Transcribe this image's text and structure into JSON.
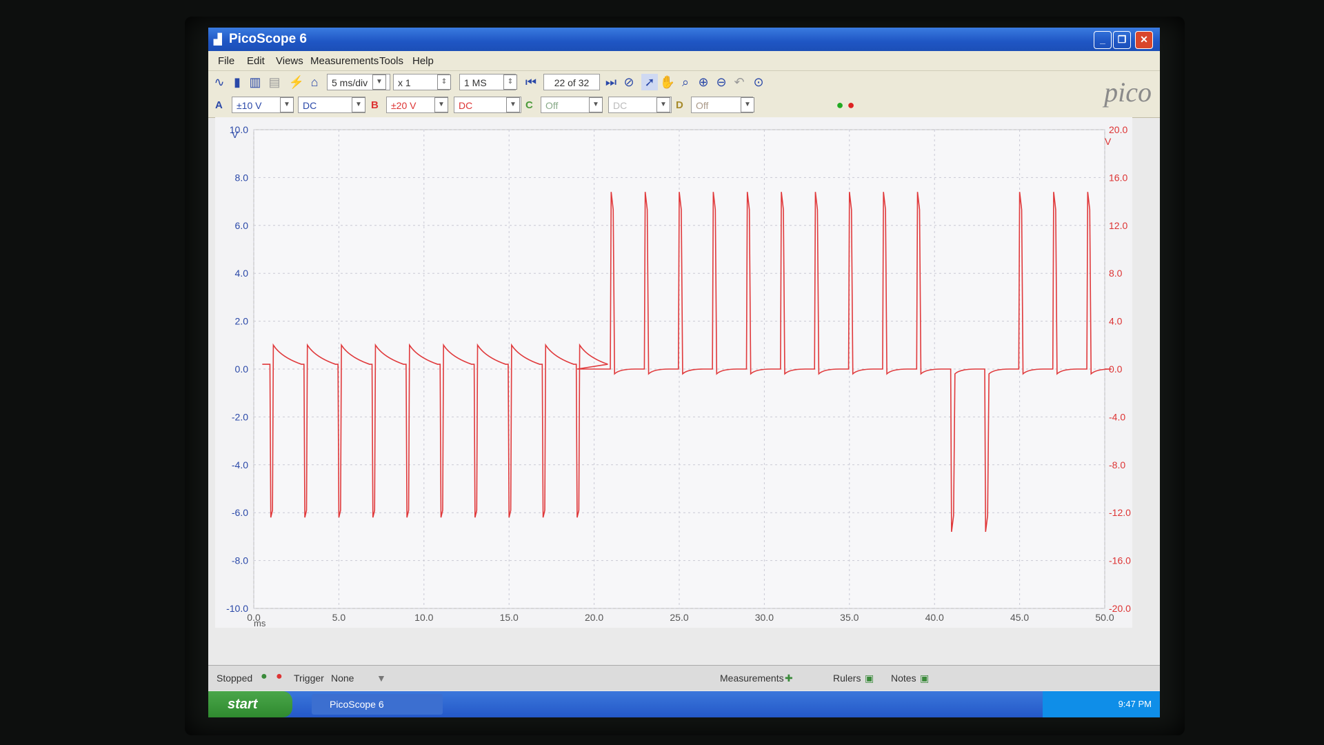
{
  "window": {
    "title": "PicoScope 6"
  },
  "menu": [
    "File",
    "Edit",
    "Views",
    "Measurements",
    "Tools",
    "Help"
  ],
  "toolbar": {
    "timebase": "5 ms/div",
    "zoom": "x 1",
    "samples": "1 MS",
    "buffer": "22 of 32"
  },
  "channels": {
    "a": {
      "label": "A",
      "range": "±10 V",
      "coupling": "DC"
    },
    "b": {
      "label": "B",
      "range": "±20 V",
      "coupling": "DC"
    },
    "c": {
      "label": "C",
      "range": "Off",
      "coupling": "DC"
    },
    "d": {
      "label": "D",
      "range": "Off"
    }
  },
  "logo": "pico",
  "chart_data": {
    "type": "line",
    "xlabel": "ms",
    "xlim": [
      0,
      50
    ],
    "x_ticks": [
      "0.0",
      "5.0",
      "10.0",
      "15.0",
      "20.0",
      "25.0",
      "30.0",
      "35.0",
      "40.0",
      "45.0",
      "50.0"
    ],
    "left_axis": {
      "unit": "V",
      "range": [
        -10,
        10
      ],
      "ticks": [
        "10.0",
        "8.0",
        "6.0",
        "4.0",
        "2.0",
        "0.0",
        "-2.0",
        "-4.0",
        "-6.0",
        "-8.0",
        "-10.0"
      ]
    },
    "right_axis": {
      "unit": "V",
      "range": [
        -20,
        20
      ],
      "ticks": [
        "20.0",
        "16.0",
        "12.0",
        "8.0",
        "4.0",
        "0.0",
        "-4.0",
        "-8.0",
        "-12.0",
        "-16.0",
        "-20.0"
      ]
    },
    "series": [
      {
        "channel": "B",
        "color": "#e0393b",
        "phase1": {
          "x_start": 0.5,
          "x_end": 19.0,
          "baseline_v": 0.2,
          "negative_pulses_ms": [
            1.0,
            3.0,
            5.0,
            7.0,
            9.0,
            11.0,
            13.0,
            15.0,
            17.0,
            19.0
          ],
          "negative_peak_v": -6.2
        },
        "phase2": {
          "x_start": 19.0,
          "x_end": 50.0,
          "baseline_v": 0.0,
          "positive_pulses_ms": [
            21.0,
            23.0,
            25.0,
            27.0,
            29.0,
            31.0,
            33.0,
            35.0,
            37.0,
            39.0,
            45.0,
            47.0,
            49.0
          ],
          "positive_peak_v": 7.4,
          "negative_pulses_ms": [
            41.0,
            43.0
          ],
          "negative_peak_v": -6.8
        }
      }
    ]
  },
  "status": {
    "state": "Stopped",
    "trigger_label": "Trigger",
    "trigger_value": "None",
    "measurements": "Measurements",
    "rulers": "Rulers",
    "notes": "Notes"
  },
  "taskbar": {
    "start": "start",
    "task": "PicoScope 6",
    "clock": "9:47 PM"
  }
}
